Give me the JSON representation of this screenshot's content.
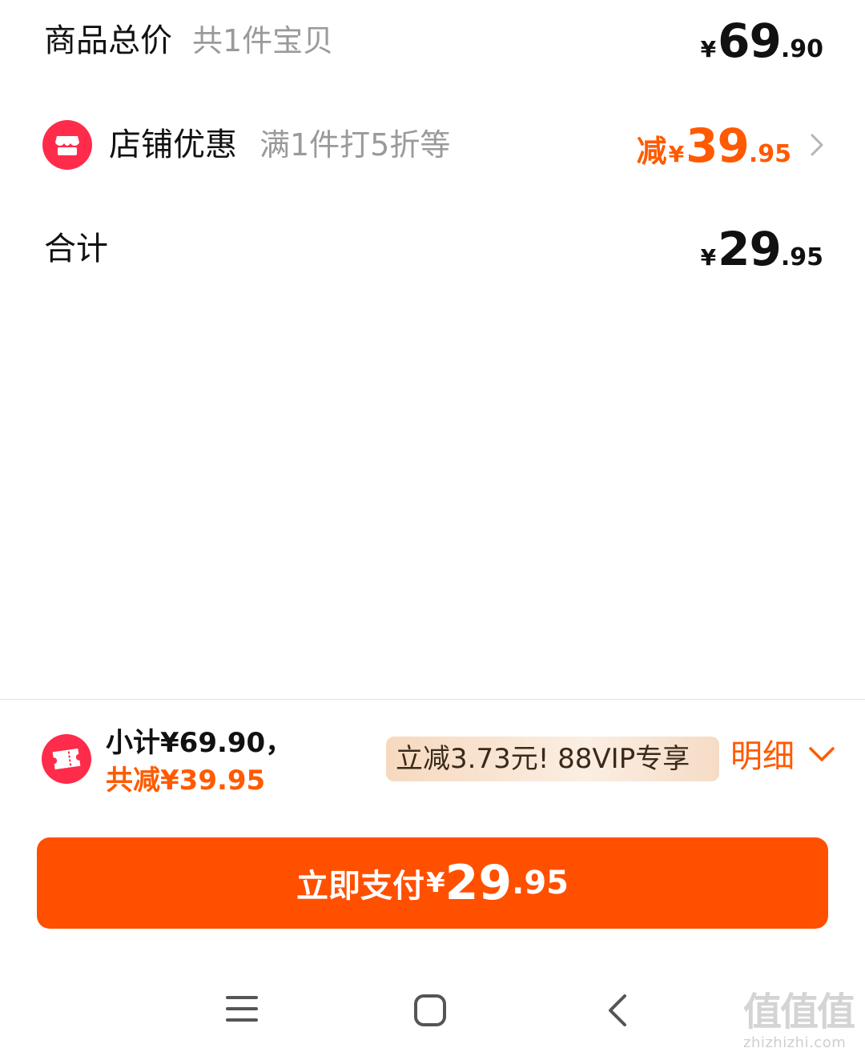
{
  "summary": {
    "goods_total": {
      "label": "商品总价",
      "sub": "共1件宝贝",
      "currency": "¥",
      "int": "69",
      "dec": ".90"
    },
    "shop_discount": {
      "label": "店铺优惠",
      "sub": "满1件打5折等",
      "prefix": "减",
      "currency": "¥",
      "int": "39",
      "dec": ".95"
    },
    "total": {
      "label": "合计",
      "currency": "¥",
      "int": "29",
      "dec": ".95"
    }
  },
  "bottom_bar": {
    "subtotal_text": "小计¥69.90，",
    "total_off_text": "共减¥39.95",
    "vip_badge": "立减3.73元! 88VIP专享",
    "detail_label": "明细"
  },
  "pay_button": {
    "label": "立即支付",
    "currency": "¥",
    "int": "29",
    "dec": ".95"
  },
  "watermark": {
    "logo": "值值值",
    "url": "zhizhizhi.com"
  },
  "colors": {
    "accent": "#ff5000",
    "discount": "#ff5a00",
    "shop_icon": "#ff2b4a"
  }
}
